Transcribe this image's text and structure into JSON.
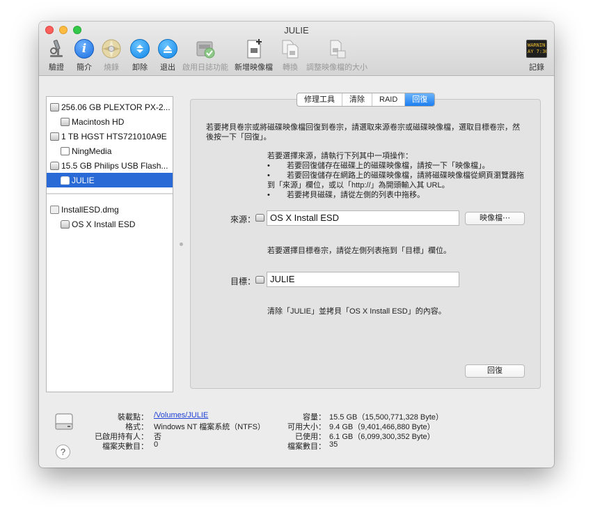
{
  "window": {
    "title": "JULIE"
  },
  "toolbar": {
    "verify": "驗證",
    "info": "簡介",
    "burn": "燒錄",
    "unmount": "卸除",
    "eject": "退出",
    "enable_journaling": "啟用日誌功能",
    "new_image": "新增映像檔",
    "convert": "轉換",
    "resize_image": "調整映像檔的大小",
    "log": "記錄",
    "log_icon_text": [
      "WARNIN",
      "AY 7:36"
    ]
  },
  "sidebar": {
    "items": [
      {
        "label": "256.06 GB PLEXTOR PX-2..."
      },
      {
        "label": "Macintosh HD"
      },
      {
        "label": "1 TB HGST HTS721010A9E"
      },
      {
        "label": "NingMedia"
      },
      {
        "label": "15.5 GB Philips USB Flash..."
      },
      {
        "label": "JULIE",
        "selected": true
      },
      {
        "label": "InstallESD.dmg"
      },
      {
        "label": "OS X Install ESD"
      }
    ]
  },
  "tabs": [
    {
      "label": "修理工具"
    },
    {
      "label": "清除"
    },
    {
      "label": "RAID"
    },
    {
      "label": "回復",
      "active": true
    }
  ],
  "restore": {
    "intro_line1": "若要拷貝卷宗或將磁碟映像檔回復到卷宗，請選取來源卷宗或磁碟映像檔，選取目標卷宗，然",
    "intro_line2": "後按一下「回復」。",
    "source_help_title": "若要選擇來源，請執行下列其中一項操作：",
    "bullet1": "若要回復儲存在磁碟上的磁碟映像檔，請按一下「映像檔」。",
    "bullet2": "若要回復儲存在網路上的磁碟映像檔，請將磁碟映像檔從網頁瀏覽器拖",
    "bullet2_cont": "到「來源」欄位，或以「http://」為開頭輸入其 URL。",
    "bullet3": "若要拷貝磁碟，請從左側的列表中拖移。",
    "bullet_char": "•",
    "source_label": "來源：",
    "source_value": "OS X Install ESD",
    "image_button": "映像檔⋯",
    "dest_help": "若要選擇目標卷宗，請從左側列表拖到「目標」欄位。",
    "dest_label": "目標：",
    "dest_value": "JULIE",
    "summary": "清除「JULIE」並拷貝「OS X Install ESD」的內容。",
    "restore_button": "回復"
  },
  "info": {
    "mount_point_key": "裝載點：",
    "mount_point_val": "/Volumes/JULIE",
    "format_key": "格式：",
    "format_val": "Windows NT 檔案系統（NTFS）",
    "owners_key": "已啟用持有人：",
    "owners_val": "否",
    "folders_key": "檔案夾數目：",
    "folders_val": "0",
    "capacity_key": "容量：",
    "capacity_val": "15.5 GB（15,500,771,328 Byte）",
    "available_key": "可用大小：",
    "available_val": "9.4 GB（9,401,466,880 Byte）",
    "used_key": "已使用：",
    "used_val": "6.1 GB（6,099,300,352 Byte）",
    "files_key": "檔案數目：",
    "files_val": "35",
    "help": "?"
  },
  "colors": {
    "selection": "#2a6ad6",
    "accent_blue": "#1c7ef0",
    "link": "#1e3fd6"
  }
}
